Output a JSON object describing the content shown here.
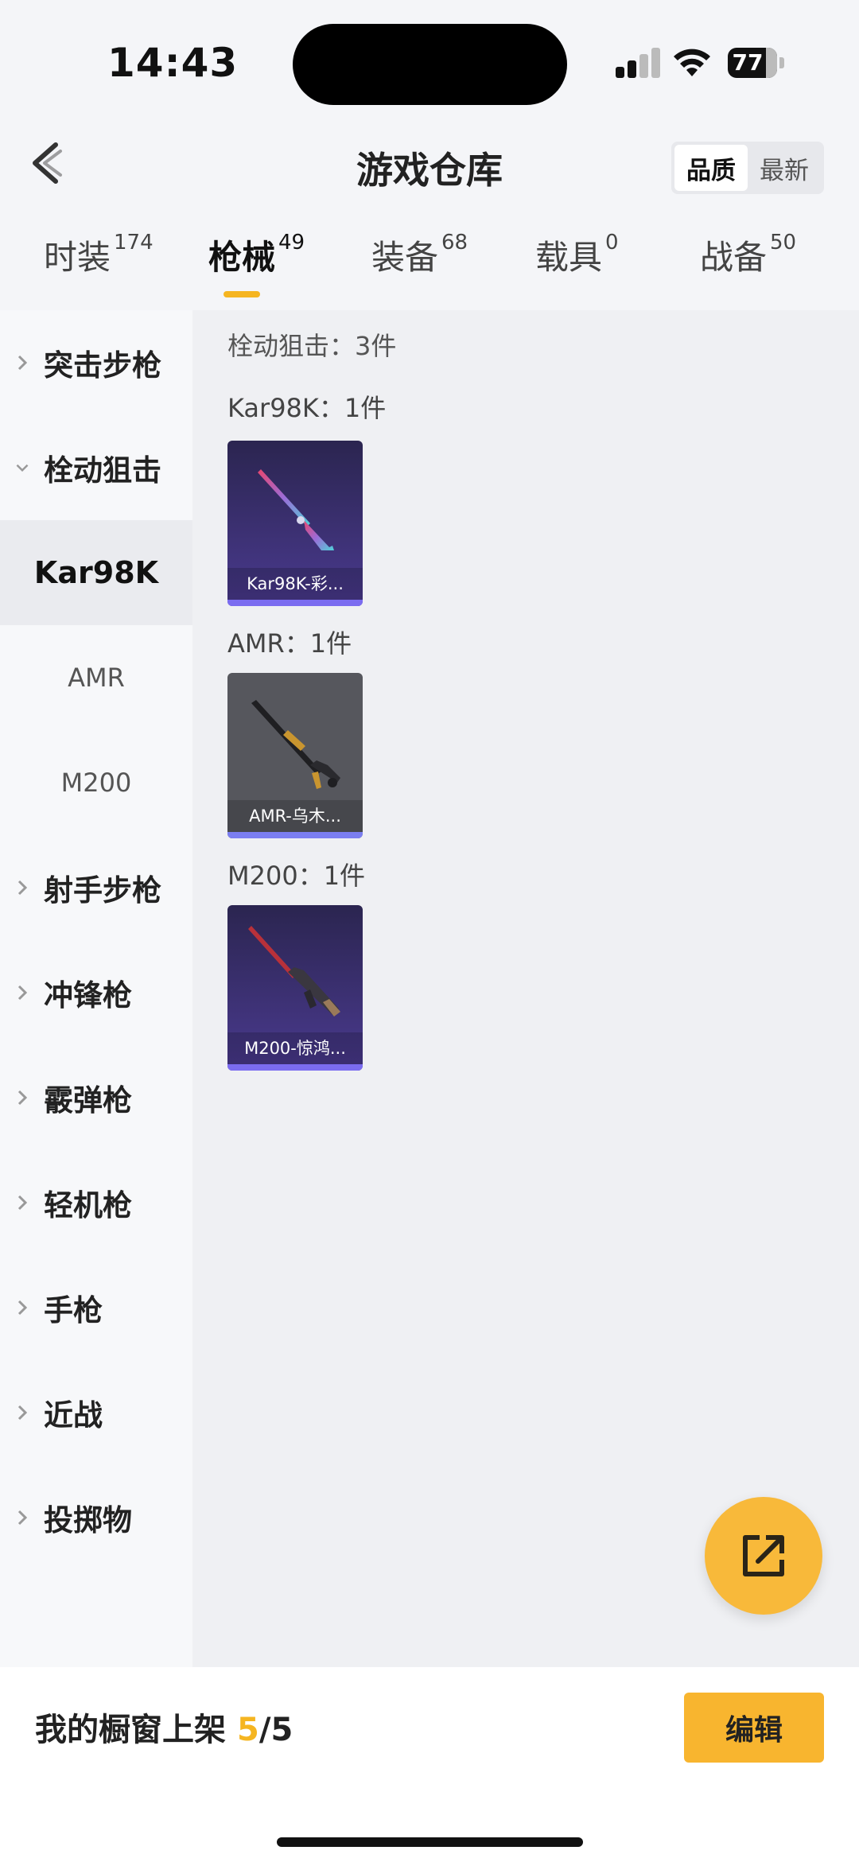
{
  "status": {
    "time": "14:43",
    "battery": "77"
  },
  "header": {
    "title": "游戏仓库",
    "sort_quality": "品质",
    "sort_newest": "最新"
  },
  "tabs": [
    {
      "label": "时装",
      "count": "174"
    },
    {
      "label": "枪械",
      "count": "49"
    },
    {
      "label": "装备",
      "count": "68"
    },
    {
      "label": "载具",
      "count": "0"
    },
    {
      "label": "战备",
      "count": "50"
    }
  ],
  "sidebar": {
    "categories": [
      "突击步枪",
      "栓动狙击",
      "射手步枪",
      "冲锋枪",
      "霰弹枪",
      "轻机枪",
      "手枪",
      "近战",
      "投掷物"
    ],
    "subitems": [
      "Kar98K",
      "AMR",
      "M200"
    ]
  },
  "content": {
    "section_title": "栓动狙击：3件",
    "groups": [
      {
        "title": "Kar98K：1件",
        "item_name": "Kar98K-彩...",
        "color": "#7b6cf0"
      },
      {
        "title": "AMR：1件",
        "item_name": "AMR-乌木...",
        "color": "#7b6cf0"
      },
      {
        "title": "M200：1件",
        "item_name": "M200-惊鸿...",
        "color": "#7b6cf0"
      }
    ]
  },
  "bottom": {
    "showcase_label": "我的橱窗上架",
    "showcase_current": "5",
    "showcase_total": "/5",
    "edit_label": "编辑"
  },
  "colors": {
    "accent": "#f5b521",
    "card_purple": "#3b2f6e",
    "card_gray": "#55565c"
  }
}
